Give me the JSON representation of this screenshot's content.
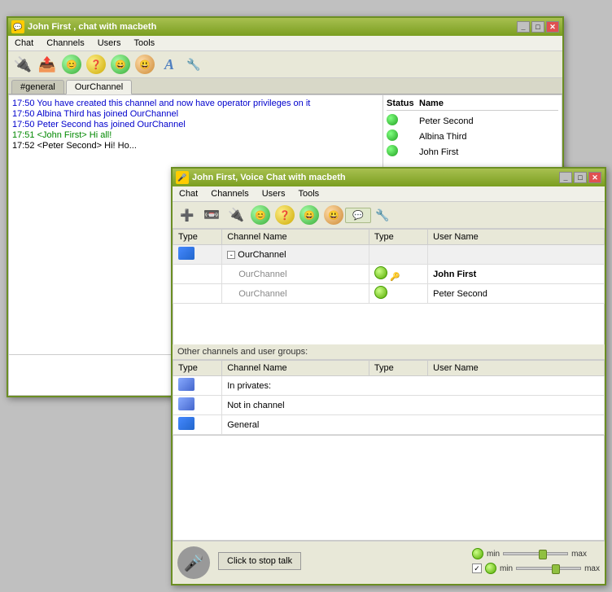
{
  "mainWindow": {
    "title": "John First , chat with macbeth",
    "menu": [
      "Chat",
      "Channels",
      "Users",
      "Tools"
    ],
    "tabs": [
      {
        "label": "#general",
        "active": false
      },
      {
        "label": "OurChannel",
        "active": true
      }
    ],
    "userList": {
      "headers": [
        "Status",
        "Name"
      ],
      "users": [
        {
          "name": "Peter Second",
          "status": "online"
        },
        {
          "name": "Albina Third",
          "status": "online"
        },
        {
          "name": "John First",
          "status": "online"
        }
      ]
    },
    "messages": [
      {
        "time": "17:50",
        "text": "You have created this channel and now have operator privileges on it",
        "color": "blue"
      },
      {
        "time": "17:50",
        "text": "Albina Third has joined OurChannel",
        "color": "blue"
      },
      {
        "time": "17:50",
        "text": "Peter Second has joined OurChannel",
        "color": "blue"
      },
      {
        "time": "17:51",
        "text": "<John First> Hi all!",
        "color": "green"
      },
      {
        "time": "17:52",
        "text": "<Peter Second> Hi! Ho...",
        "color": "black"
      }
    ]
  },
  "voiceWindow": {
    "title": "John First, Voice Chat with macbeth",
    "menu": [
      "Chat",
      "Channels",
      "Users",
      "Tools"
    ],
    "tableHeaders": [
      "Type",
      "Channel Name",
      "Type",
      "User Name"
    ],
    "channelRows": [
      {
        "channelName": "OurChannel",
        "expand": true
      },
      {
        "channelName": "OurChannel",
        "userName": "John First",
        "bold": true
      },
      {
        "channelName": "OurChannel",
        "userName": "Peter Second",
        "bold": false
      }
    ],
    "otherSectionLabel": "Other channels and user groups:",
    "otherHeaders": [
      "Type",
      "Channel Name",
      "Type",
      "User Name"
    ],
    "otherRows": [
      {
        "text": "In privates:"
      },
      {
        "text": "Not in channel"
      },
      {
        "text": "General"
      }
    ],
    "footer": {
      "buttonLabel": "Click to stop talk",
      "slider1": {
        "min": "min",
        "max": "max",
        "thumbPos": 60
      },
      "slider2": {
        "min": "min",
        "max": "max",
        "thumbPos": 60
      },
      "checked": true
    }
  }
}
